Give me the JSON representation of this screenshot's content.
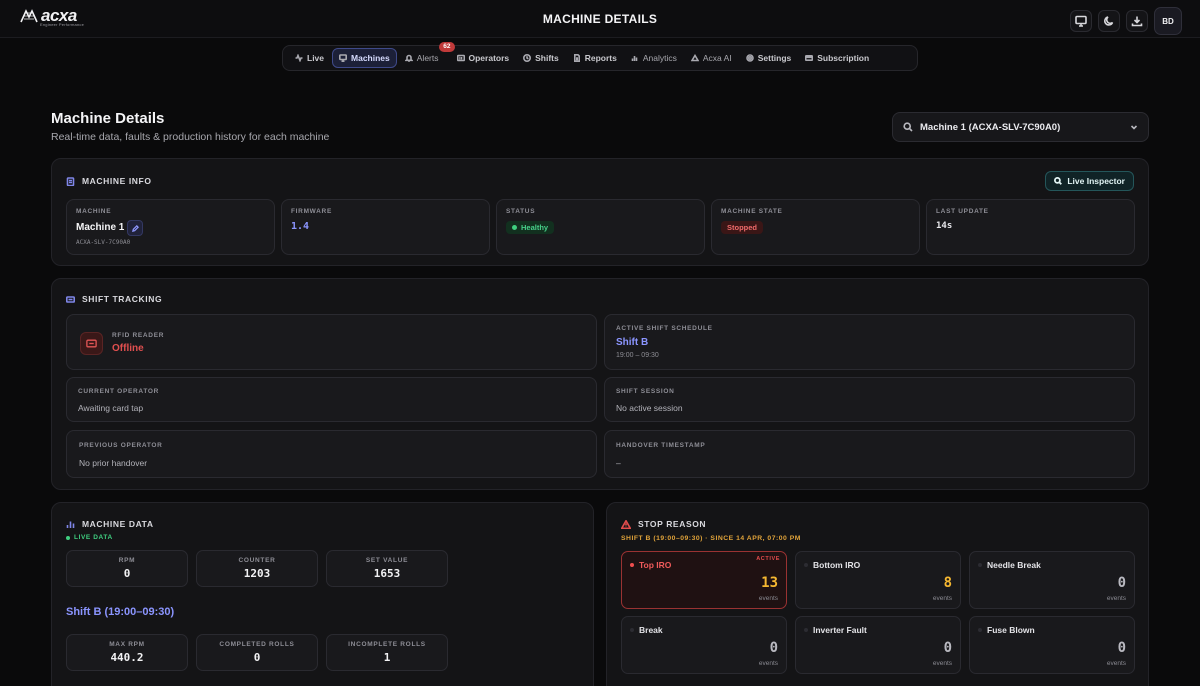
{
  "brand": {
    "name": "acxa",
    "tagline": "Engineer Performance"
  },
  "header": {
    "title": "MACHINE DETAILS",
    "avatar_initials": "BD"
  },
  "nav": [
    {
      "label": "Live",
      "icon": "pulse-icon"
    },
    {
      "label": "Machines",
      "icon": "monitor-icon",
      "active": true
    },
    {
      "label": "Alerts",
      "icon": "bell-icon",
      "badge": "62"
    },
    {
      "label": "Operators",
      "icon": "id-card-icon"
    },
    {
      "label": "Shifts",
      "icon": "clock-icon"
    },
    {
      "label": "Reports",
      "icon": "document-icon"
    },
    {
      "label": "Analytics",
      "icon": "bar-chart-icon"
    },
    {
      "label": "Acxa AI",
      "icon": "sparkle-icon"
    },
    {
      "label": "Settings",
      "icon": "gear-icon"
    },
    {
      "label": "Subscription",
      "icon": "card-icon"
    }
  ],
  "page": {
    "title": "Machine Details",
    "subtitle": "Real-time data, faults & production history for each machine",
    "machine_select": "Machine 1 (ACXA-SLV-7C90A0)"
  },
  "machine_info": {
    "title": "MACHINE INFO",
    "live_inspector": "Live Inspector",
    "machine_label": "MACHINE",
    "machine_name": "Machine 1",
    "machine_id": "ACXA-SLV-7C90A0",
    "firmware_label": "FIRMWARE",
    "firmware": "1.4",
    "status_label": "STATUS",
    "status": "Healthy",
    "state_label": "MACHINE STATE",
    "state": "Stopped",
    "last_update_label": "LAST UPDATE",
    "last_update": "14s"
  },
  "shift_tracking": {
    "title": "SHIFT TRACKING",
    "rfid_label": "RFID READER",
    "rfid_status": "Offline",
    "schedule_label": "ACTIVE SHIFT SCHEDULE",
    "schedule_name": "Shift B",
    "schedule_time": "19:00 – 09:30",
    "operator_label": "CURRENT OPERATOR",
    "operator_value": "Awaiting card tap",
    "session_label": "SHIFT SESSION",
    "session_value": "No active session",
    "prev_label": "PREVIOUS OPERATOR",
    "prev_value": "No prior handover",
    "handover_label": "HANDOVER TIMESTAMP",
    "handover_value": "–"
  },
  "machine_data": {
    "title": "MACHINE DATA",
    "live": "LIVE DATA",
    "rpm_label": "RPM",
    "rpm": "0",
    "counter_label": "COUNTER",
    "counter": "1203",
    "set_label": "SET VALUE",
    "set_value": "1653",
    "shift_title": "Shift B (19:00–09:30)",
    "max_rpm_label": "MAX RPM",
    "max_rpm": "440.2",
    "completed_label": "COMPLETED ROLLS",
    "completed": "0",
    "incomplete_label": "INCOMPLETE ROLLS",
    "incomplete": "1"
  },
  "stop_reason": {
    "title": "STOP REASON",
    "subtitle": "SHIFT B (19:00–09:30) · SINCE 14 APR, 07:00 PM",
    "active_tag": "ACTIVE",
    "events_label": "events",
    "items": [
      {
        "name": "Top IRO",
        "count": "13"
      },
      {
        "name": "Bottom IRO",
        "count": "8"
      },
      {
        "name": "Needle Break",
        "count": "0"
      },
      {
        "name": "Break",
        "count": "0"
      },
      {
        "name": "Inverter Fault",
        "count": "0"
      },
      {
        "name": "Fuse Blown",
        "count": "0"
      }
    ]
  },
  "colors": {
    "accent": "#8b95ff",
    "danger": "#ef5a5a",
    "success": "#47d18a",
    "warning": "#f5b731"
  }
}
